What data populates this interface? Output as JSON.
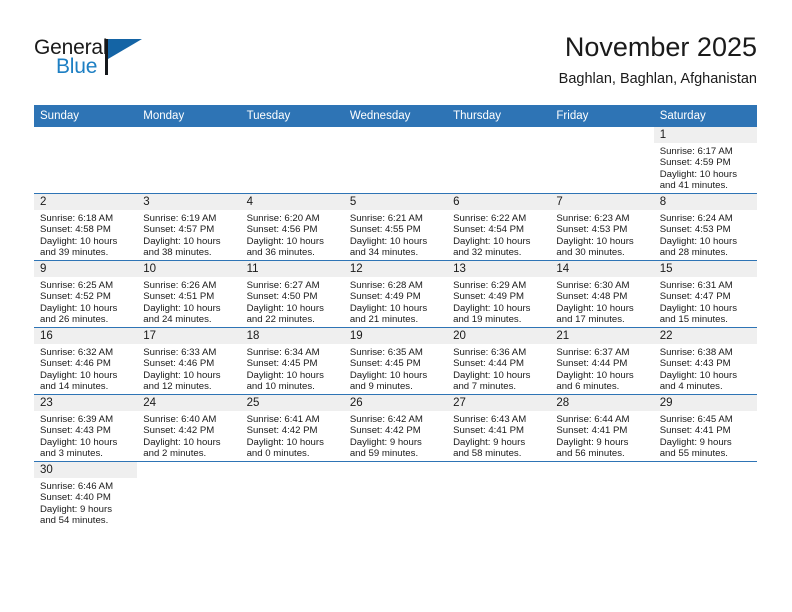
{
  "brand": {
    "word_general": "General",
    "word_blue": "Blue",
    "flag_icon": "triangle-flag-icon"
  },
  "header": {
    "month_title": "November 2025",
    "location": "Baghlan, Baghlan, Afghanistan"
  },
  "theme": {
    "header_blue": "#2e74b5",
    "band_gray": "#efefef",
    "brand_blue": "#1d7fc3",
    "text": "#1a1a1a"
  },
  "calendar": {
    "weekday_headers": [
      "Sunday",
      "Monday",
      "Tuesday",
      "Wednesday",
      "Thursday",
      "Friday",
      "Saturday"
    ],
    "weeks": [
      [
        {
          "day": "",
          "lines": []
        },
        {
          "day": "",
          "lines": []
        },
        {
          "day": "",
          "lines": []
        },
        {
          "day": "",
          "lines": []
        },
        {
          "day": "",
          "lines": []
        },
        {
          "day": "",
          "lines": []
        },
        {
          "day": "1",
          "lines": [
            "Sunrise: 6:17 AM",
            "Sunset: 4:59 PM",
            "Daylight: 10 hours",
            "and 41 minutes."
          ]
        }
      ],
      [
        {
          "day": "2",
          "lines": [
            "Sunrise: 6:18 AM",
            "Sunset: 4:58 PM",
            "Daylight: 10 hours",
            "and 39 minutes."
          ]
        },
        {
          "day": "3",
          "lines": [
            "Sunrise: 6:19 AM",
            "Sunset: 4:57 PM",
            "Daylight: 10 hours",
            "and 38 minutes."
          ]
        },
        {
          "day": "4",
          "lines": [
            "Sunrise: 6:20 AM",
            "Sunset: 4:56 PM",
            "Daylight: 10 hours",
            "and 36 minutes."
          ]
        },
        {
          "day": "5",
          "lines": [
            "Sunrise: 6:21 AM",
            "Sunset: 4:55 PM",
            "Daylight: 10 hours",
            "and 34 minutes."
          ]
        },
        {
          "day": "6",
          "lines": [
            "Sunrise: 6:22 AM",
            "Sunset: 4:54 PM",
            "Daylight: 10 hours",
            "and 32 minutes."
          ]
        },
        {
          "day": "7",
          "lines": [
            "Sunrise: 6:23 AM",
            "Sunset: 4:53 PM",
            "Daylight: 10 hours",
            "and 30 minutes."
          ]
        },
        {
          "day": "8",
          "lines": [
            "Sunrise: 6:24 AM",
            "Sunset: 4:53 PM",
            "Daylight: 10 hours",
            "and 28 minutes."
          ]
        }
      ],
      [
        {
          "day": "9",
          "lines": [
            "Sunrise: 6:25 AM",
            "Sunset: 4:52 PM",
            "Daylight: 10 hours",
            "and 26 minutes."
          ]
        },
        {
          "day": "10",
          "lines": [
            "Sunrise: 6:26 AM",
            "Sunset: 4:51 PM",
            "Daylight: 10 hours",
            "and 24 minutes."
          ]
        },
        {
          "day": "11",
          "lines": [
            "Sunrise: 6:27 AM",
            "Sunset: 4:50 PM",
            "Daylight: 10 hours",
            "and 22 minutes."
          ]
        },
        {
          "day": "12",
          "lines": [
            "Sunrise: 6:28 AM",
            "Sunset: 4:49 PM",
            "Daylight: 10 hours",
            "and 21 minutes."
          ]
        },
        {
          "day": "13",
          "lines": [
            "Sunrise: 6:29 AM",
            "Sunset: 4:49 PM",
            "Daylight: 10 hours",
            "and 19 minutes."
          ]
        },
        {
          "day": "14",
          "lines": [
            "Sunrise: 6:30 AM",
            "Sunset: 4:48 PM",
            "Daylight: 10 hours",
            "and 17 minutes."
          ]
        },
        {
          "day": "15",
          "lines": [
            "Sunrise: 6:31 AM",
            "Sunset: 4:47 PM",
            "Daylight: 10 hours",
            "and 15 minutes."
          ]
        }
      ],
      [
        {
          "day": "16",
          "lines": [
            "Sunrise: 6:32 AM",
            "Sunset: 4:46 PM",
            "Daylight: 10 hours",
            "and 14 minutes."
          ]
        },
        {
          "day": "17",
          "lines": [
            "Sunrise: 6:33 AM",
            "Sunset: 4:46 PM",
            "Daylight: 10 hours",
            "and 12 minutes."
          ]
        },
        {
          "day": "18",
          "lines": [
            "Sunrise: 6:34 AM",
            "Sunset: 4:45 PM",
            "Daylight: 10 hours",
            "and 10 minutes."
          ]
        },
        {
          "day": "19",
          "lines": [
            "Sunrise: 6:35 AM",
            "Sunset: 4:45 PM",
            "Daylight: 10 hours",
            "and 9 minutes."
          ]
        },
        {
          "day": "20",
          "lines": [
            "Sunrise: 6:36 AM",
            "Sunset: 4:44 PM",
            "Daylight: 10 hours",
            "and 7 minutes."
          ]
        },
        {
          "day": "21",
          "lines": [
            "Sunrise: 6:37 AM",
            "Sunset: 4:44 PM",
            "Daylight: 10 hours",
            "and 6 minutes."
          ]
        },
        {
          "day": "22",
          "lines": [
            "Sunrise: 6:38 AM",
            "Sunset: 4:43 PM",
            "Daylight: 10 hours",
            "and 4 minutes."
          ]
        }
      ],
      [
        {
          "day": "23",
          "lines": [
            "Sunrise: 6:39 AM",
            "Sunset: 4:43 PM",
            "Daylight: 10 hours",
            "and 3 minutes."
          ]
        },
        {
          "day": "24",
          "lines": [
            "Sunrise: 6:40 AM",
            "Sunset: 4:42 PM",
            "Daylight: 10 hours",
            "and 2 minutes."
          ]
        },
        {
          "day": "25",
          "lines": [
            "Sunrise: 6:41 AM",
            "Sunset: 4:42 PM",
            "Daylight: 10 hours",
            "and 0 minutes."
          ]
        },
        {
          "day": "26",
          "lines": [
            "Sunrise: 6:42 AM",
            "Sunset: 4:42 PM",
            "Daylight: 9 hours",
            "and 59 minutes."
          ]
        },
        {
          "day": "27",
          "lines": [
            "Sunrise: 6:43 AM",
            "Sunset: 4:41 PM",
            "Daylight: 9 hours",
            "and 58 minutes."
          ]
        },
        {
          "day": "28",
          "lines": [
            "Sunrise: 6:44 AM",
            "Sunset: 4:41 PM",
            "Daylight: 9 hours",
            "and 56 minutes."
          ]
        },
        {
          "day": "29",
          "lines": [
            "Sunrise: 6:45 AM",
            "Sunset: 4:41 PM",
            "Daylight: 9 hours",
            "and 55 minutes."
          ]
        }
      ],
      [
        {
          "day": "30",
          "lines": [
            "Sunrise: 6:46 AM",
            "Sunset: 4:40 PM",
            "Daylight: 9 hours",
            "and 54 minutes."
          ]
        },
        {
          "day": "",
          "lines": []
        },
        {
          "day": "",
          "lines": []
        },
        {
          "day": "",
          "lines": []
        },
        {
          "day": "",
          "lines": []
        },
        {
          "day": "",
          "lines": []
        },
        {
          "day": "",
          "lines": []
        }
      ]
    ]
  }
}
